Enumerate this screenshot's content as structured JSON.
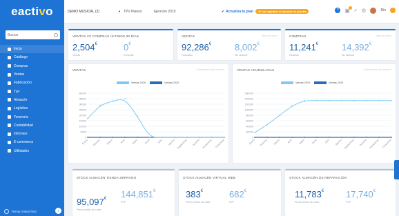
{
  "brand": {
    "logo_main": "eacti",
    "logo_accent": "v",
    "logo_tail": "o"
  },
  "sidebar": {
    "search_placeholder": "Buscar",
    "items": [
      {
        "label": "Inicio",
        "icon": "home-icon"
      },
      {
        "label": "Catálogo",
        "icon": "book-icon"
      },
      {
        "label": "Compras",
        "icon": "cart-icon"
      },
      {
        "label": "Ventas",
        "icon": "tag-icon"
      },
      {
        "label": "Fabricación",
        "icon": "factory-icon"
      },
      {
        "label": "Tpv",
        "icon": "pos-icon"
      },
      {
        "label": "Almacén",
        "icon": "warehouse-icon"
      },
      {
        "label": "Logística",
        "icon": "truck-icon"
      },
      {
        "label": "Tesorería",
        "icon": "euro-icon"
      },
      {
        "label": "Contabilidad",
        "icon": "calculator-icon"
      },
      {
        "label": "Informes",
        "icon": "chart-icon"
      },
      {
        "label": "E-commerce",
        "icon": "store-icon"
      },
      {
        "label": "Utilidades",
        "icon": "wrench-icon"
      }
    ],
    "bottom_label": "Tiempo hasta final"
  },
  "topbar": {
    "company": "DEMO MUSICAL (2)",
    "tpv": "TPV Planos",
    "exercise": "Ejercicio 2019",
    "update_label": "Actualiza tu plan",
    "update_badge": "Te has agotado el periodo de prueba",
    "user": "Rio"
  },
  "kpis": [
    {
      "title": "VENTAS VS COMPRAS ÚLTIMOS 30 DÍAS",
      "value1": "2,504",
      "unit1": "€",
      "sub1": "Ventas",
      "value2": "0",
      "unit2": "€",
      "sub2": "Compras",
      "right": ""
    },
    {
      "title": "VENTAS",
      "value1": "92,286",
      "unit1": "€",
      "sub1": "Facturado",
      "value2": "8,002",
      "unit2": "€",
      "sub2": "Sin facturar",
      "right": "Mes en curso"
    },
    {
      "title": "COMPRAS",
      "value1": "11,241",
      "unit1": "€",
      "sub1": "Recibido",
      "value2": "14,392",
      "unit2": "€",
      "sub2": "Sin facturar",
      "right": "Mes en curso"
    }
  ],
  "charts_text": [
    {
      "title": "VENTAS",
      "right": "Comparativa año anterior"
    },
    {
      "title": "VENTAS ACUMULADAS",
      "right": "Comparativa año anterior"
    }
  ],
  "stock": [
    {
      "title": "STOCK ALMACÉN TIENDA SERRANO",
      "value1": "95,097",
      "unit1": "€",
      "sub1": "Precio medio de coste",
      "value2": "144,851",
      "unit2": "€",
      "sub2": "PVP"
    },
    {
      "title": "STOCK ALMACÉN VIRTUAL WEB",
      "value1": "383",
      "unit1": "€",
      "sub1": "Precio medio de coste",
      "value2": "682",
      "unit2": "€",
      "sub2": "PVP"
    },
    {
      "title": "STOCK ALMACÉN DE REPARACIÓN",
      "value1": "11,783",
      "unit1": "€",
      "sub1": "Precio medio de coste",
      "value2": "17,740",
      "unit2": "€",
      "sub2": "PVP"
    }
  ],
  "colors": {
    "accent": "#1e74d4",
    "series2019": "#7ecbf2",
    "series2020": "#2a6db5"
  },
  "chart_data": [
    {
      "type": "line",
      "title": "VENTAS",
      "categories": [
        "Enero",
        "Febrero",
        "Marzo",
        "Abril",
        "Mayo",
        "Junio",
        "Julio",
        "Agosto",
        "Septiembre",
        "Octubre",
        "Noviembre",
        "Diciembre"
      ],
      "series": [
        {
          "name": "Ventas 2019",
          "values": [
            17000,
            29000,
            33000,
            35000,
            19000,
            0,
            0,
            0,
            0,
            0,
            0,
            0
          ]
        },
        {
          "name": "Ventas 2020",
          "values": [
            0,
            0,
            0,
            0,
            0,
            0,
            0,
            0,
            0,
            0,
            0,
            0
          ]
        }
      ],
      "ylim": [
        0,
        40000
      ],
      "yticks": [
        0,
        5000,
        10000,
        15000,
        20000,
        25000,
        30000,
        35000,
        40000
      ],
      "grid": true,
      "legend": "top"
    },
    {
      "type": "line",
      "title": "VENTAS ACUMULADAS",
      "categories": [
        "Enero",
        "Febrero",
        "Marzo",
        "Abril",
        "Mayo",
        "Junio",
        "Julio",
        "Agosto",
        "Septiembre",
        "Octubre",
        "Noviembre",
        "Diciembre"
      ],
      "series": [
        {
          "name": "Ventas 2019",
          "values": [
            17000,
            46000,
            79000,
            114000,
            133000,
            133000,
            133000,
            133000,
            133000,
            133000,
            133000,
            133000
          ]
        },
        {
          "name": "Ventas 2020",
          "values": [
            0,
            0,
            0,
            0,
            0,
            0,
            0,
            0,
            0,
            0,
            0,
            0
          ]
        }
      ],
      "ylim": [
        0,
        160000
      ],
      "yticks": [
        0,
        20000,
        40000,
        60000,
        80000,
        100000,
        120000,
        140000,
        160000
      ],
      "grid": true,
      "legend": "top"
    }
  ]
}
